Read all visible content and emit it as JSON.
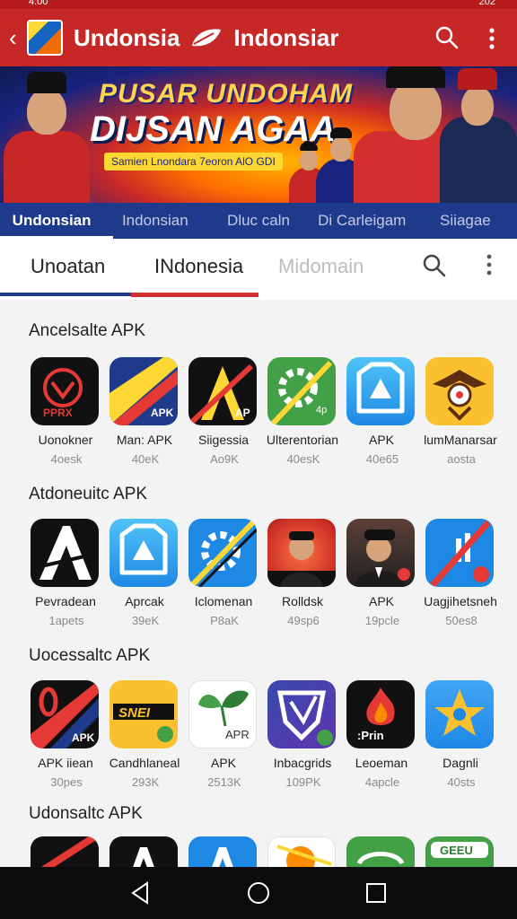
{
  "status": {
    "left": "4:00",
    "right": "202"
  },
  "appbar": {
    "title": "Undonsia",
    "title2": "Indonsiar",
    "logo": "app-logo",
    "icons": [
      "back-icon",
      "leaf-icon",
      "search-icon",
      "more-icon"
    ]
  },
  "banner": {
    "line1": "PUSAR UNDOHAM",
    "line2": "DIJSAN AGAA",
    "sub": "Samien Lnondara 7eoron AlO GDI"
  },
  "tabs1": [
    "Undonsian",
    "Indonsian",
    "Dluc caln",
    "Di Carleigam",
    "Siiagae"
  ],
  "tabs2": {
    "items": [
      "Unoatan",
      "INdonesia",
      "Midomain"
    ]
  },
  "sections": [
    {
      "title": "Ancelsalte APK",
      "apps": [
        {
          "name": "Uonokner",
          "size": "4oesk"
        },
        {
          "name": "Man: APK",
          "size": "40eK"
        },
        {
          "name": "Siigessia",
          "size": "Ao9K"
        },
        {
          "name": "Ulterentorian",
          "size": "40esK"
        },
        {
          "name": "APK",
          "size": "40e65"
        },
        {
          "name": "lumManarsar",
          "size": "aosta"
        }
      ]
    },
    {
      "title": "Atdoneuitc APK",
      "apps": [
        {
          "name": "Pevradean",
          "size": "1apets"
        },
        {
          "name": "Aprcak",
          "size": "39eK"
        },
        {
          "name": "Iclomenan",
          "size": "P8aK"
        },
        {
          "name": "Rolldsk",
          "size": "49sp6"
        },
        {
          "name": "APK",
          "size": "19pcle"
        },
        {
          "name": "Uagjihetsneh",
          "size": "50es8"
        }
      ]
    },
    {
      "title": "Uocessaltc APK",
      "apps": [
        {
          "name": "APK iiean",
          "size": "30pes"
        },
        {
          "name": "Candhlaneal",
          "size": "293K"
        },
        {
          "name": "APK",
          "size": "2513K"
        },
        {
          "name": "Inbacgrids",
          "size": "109PK"
        },
        {
          "name": "Leoeman",
          "size": "4apcle"
        },
        {
          "name": "Dagnli",
          "size": "40sts"
        }
      ]
    },
    {
      "title": "Udonsaltc APK",
      "apps": [
        {
          "name": "",
          "size": ""
        },
        {
          "name": "",
          "size": ""
        },
        {
          "name": "",
          "size": ""
        },
        {
          "name": "",
          "size": ""
        },
        {
          "name": "",
          "size": ""
        },
        {
          "name": "",
          "size": ""
        }
      ]
    }
  ],
  "icon_labels": {
    "apk": "APK",
    "ap": "AP",
    "ap4": "4p",
    "apr": "APR",
    "pprx": "PPRX",
    "prin": ":Prin",
    "snei": "SNEI",
    "geeu": "GEEU"
  },
  "navbar": {
    "icons": [
      "back-nav-icon",
      "home-nav-icon",
      "recents-nav-icon"
    ]
  }
}
